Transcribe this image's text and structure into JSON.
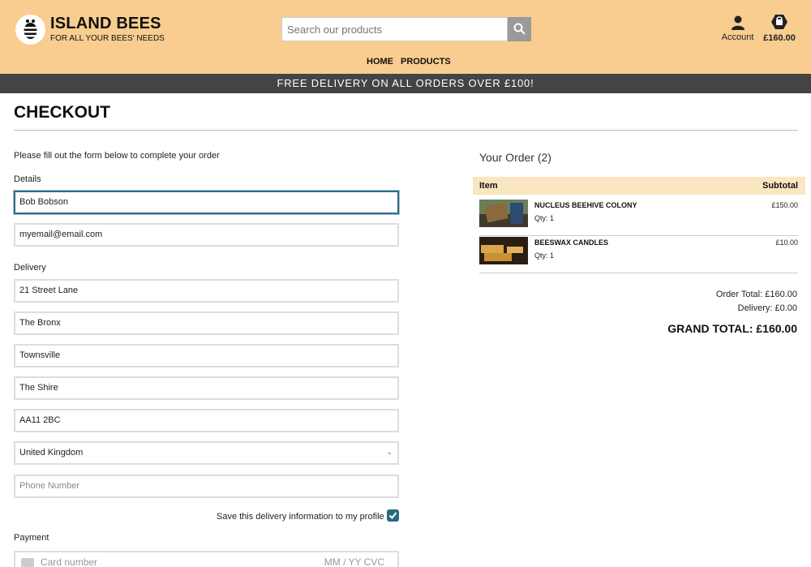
{
  "brand": {
    "title": "ISLAND BEES",
    "subtitle": "FOR ALL YOUR BEES' NEEDS"
  },
  "search": {
    "placeholder": "Search our products"
  },
  "header": {
    "account_label": "Account",
    "bag_total": "£160.00"
  },
  "nav": {
    "home": "HOME",
    "products": "PRODUCTS"
  },
  "banner": "FREE DELIVERY ON ALL ORDERS OVER £100!",
  "page_title": "CHECKOUT",
  "form": {
    "instructions": "Please fill out the form below to complete your order",
    "details_label": "Details",
    "full_name": "Bob Bobson",
    "email": "myemail@email.com",
    "delivery_label": "Delivery",
    "street1": "21 Street Lane",
    "street2": "The Bronx",
    "town": "Townsville",
    "county": "The Shire",
    "postcode": "AA11 2BC",
    "country": "United Kingdom",
    "phone_placeholder": "Phone Number",
    "save_info_label": "Save this delivery information to my profile",
    "save_info_checked": true,
    "payment_label": "Payment",
    "card_placeholder": "Card number",
    "card_right_placeholder": "MM / YY  CVC"
  },
  "order": {
    "title": "Your Order (2)",
    "col_item": "Item",
    "col_subtotal": "Subtotal",
    "items": [
      {
        "name": "NUCLEUS BEEHIVE COLONY",
        "qty": "Qty: 1",
        "price": "£150.00"
      },
      {
        "name": "BEESWAX CANDLES",
        "qty": "Qty: 1",
        "price": "£10.00"
      }
    ],
    "order_total": "Order Total: £160.00",
    "delivery": "Delivery: £0.00",
    "grand_total": "GRAND TOTAL: £160.00"
  },
  "colors": {
    "header_bg": "#f8cd8f",
    "banner_bg": "#444444",
    "table_head_bg": "#fbe6c2",
    "accent": "#2b6980"
  },
  "icons": [
    "bee-logo-icon",
    "search-icon",
    "account-icon",
    "shopping-bag-icon",
    "checkmark-icon",
    "credit-card-icon",
    "chevron-down-icon"
  ]
}
